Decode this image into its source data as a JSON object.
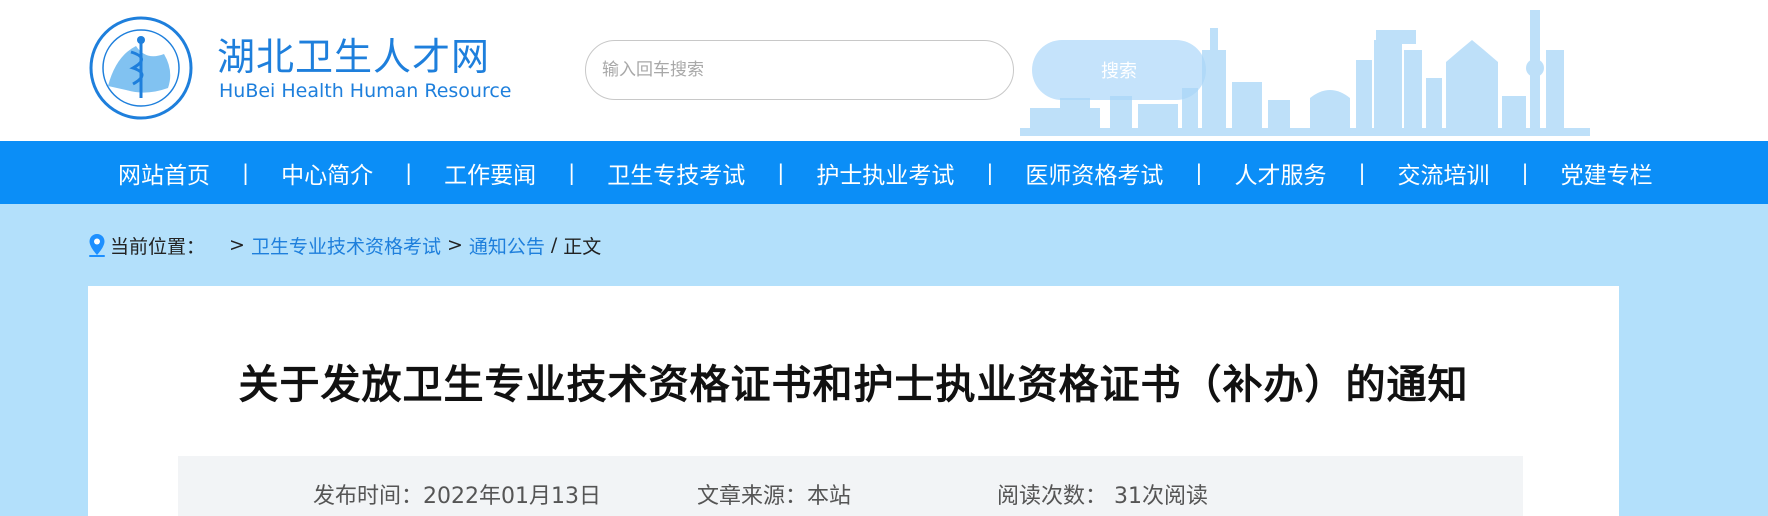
{
  "site": {
    "title": "湖北卫生人才网",
    "subtitle": "HuBei Health Human Resource"
  },
  "search": {
    "placeholder": "输入回车搜索",
    "button_label": "搜索"
  },
  "nav": {
    "items": [
      "网站首页",
      "中心简介",
      "工作要闻",
      "卫生专技考试",
      "护士执业考试",
      "医师资格考试",
      "人才服务",
      "交流培训",
      "党建专栏"
    ],
    "separator": "|"
  },
  "breadcrumb": {
    "label": "当前位置：",
    "arrow": ">",
    "items": [
      "卫生专业技术资格考试",
      "通知公告"
    ],
    "divider": "/",
    "current": "正文"
  },
  "article": {
    "title": "关于发放卫生专业技术资格证书和护士执业资格证书（补办）的通知",
    "publish_time": "发布时间：2022年01月13日",
    "source": "文章来源：本站",
    "views": "阅读次数： 31次阅读"
  },
  "colors": {
    "brand_blue": "#1e7fdc",
    "nav_blue": "#0b8ef7",
    "page_bg": "#b3e0fb"
  }
}
